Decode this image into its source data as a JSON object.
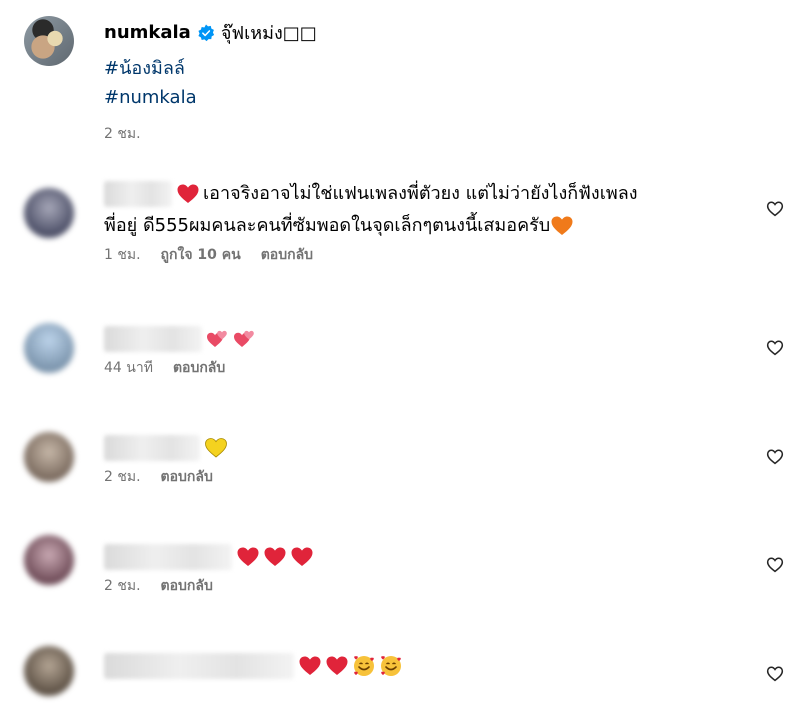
{
  "post": {
    "username": "numkala",
    "caption": "จุ๊ฟเหม่ง",
    "caption_suffix": "□□",
    "hashtags": [
      "#น้องมิลล์",
      "#numkala"
    ],
    "time": "2 ชม."
  },
  "comments": [
    {
      "text": "เอาจริงอาจไม่ใช่แฟนเพลงพี่ตัวยง แต่ไม่ว่ายังไงก็ฟังเพลงพี่อยู่ ดี555ผมคนละคนที่ซัมพอดในจุดเล็กๆตนงนี้เสมอครับ",
      "text_line1": "เอาจริงอาจไม่ใช่แฟนเพลงพี่ตัวยง แต่ไม่ว่ายังไงก็ฟังเพลง",
      "text_line2": "พี่อยู่ ดี555ผมคนละคนที่ซัมพอดในจุดเล็กๆตนงนี้เสมอครับ",
      "time": "1 ชม.",
      "likes": "ถูกใจ 10 คน",
      "reply": "ตอบกลับ"
    },
    {
      "time": "44 นาที",
      "reply": "ตอบกลับ"
    },
    {
      "time": "2 ชม.",
      "reply": "ตอบกลับ"
    },
    {
      "time": "2 ชม.",
      "reply": "ตอบกลับ"
    },
    {
      "time": "",
      "reply": ""
    }
  ],
  "icons": {
    "verified": "verified-badge-icon",
    "like": "heart-outline-icon",
    "red_heart": "red-heart-emoji",
    "orange_heart": "orange-heart-emoji",
    "two_hearts": "two-hearts-emoji",
    "yellow_heart": "yellow-heart-emoji",
    "smiling_hearts": "smiling-face-with-hearts-emoji"
  },
  "colors": {
    "link": "#00376b",
    "meta": "#737373",
    "verified": "#0095f6",
    "red_heart": "#e0243a",
    "orange_heart": "#f07a1a",
    "yellow_heart": "#f4d21f"
  }
}
